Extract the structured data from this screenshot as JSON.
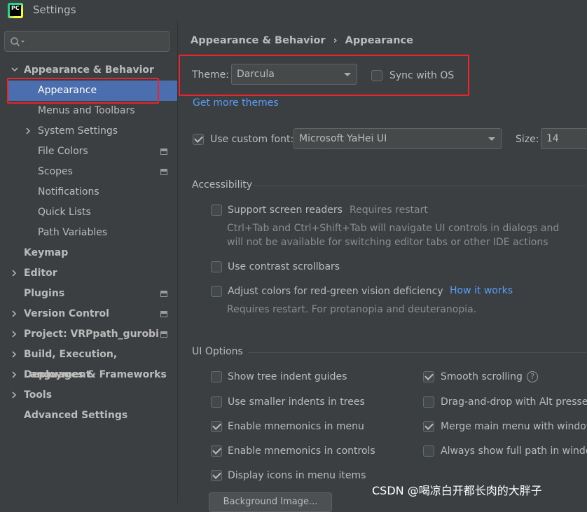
{
  "window": {
    "title": "Settings",
    "app_icon_text": "PC"
  },
  "sidebar": {
    "search_placeholder": "",
    "items": [
      {
        "label": "Appearance & Behavior"
      },
      {
        "label": "Appearance"
      },
      {
        "label": "Menus and Toolbars"
      },
      {
        "label": "System Settings"
      },
      {
        "label": "File Colors"
      },
      {
        "label": "Scopes"
      },
      {
        "label": "Notifications"
      },
      {
        "label": "Quick Lists"
      },
      {
        "label": "Path Variables"
      },
      {
        "label": "Keymap"
      },
      {
        "label": "Editor"
      },
      {
        "label": "Plugins"
      },
      {
        "label": "Version Control"
      },
      {
        "label": "Project: VRPpath_gurobi"
      },
      {
        "label": "Build, Execution, Deployment"
      },
      {
        "label": "Languages & Frameworks"
      },
      {
        "label": "Tools"
      },
      {
        "label": "Advanced Settings"
      }
    ]
  },
  "breadcrumb": {
    "parent": "Appearance & Behavior",
    "separator": "›",
    "current": "Appearance"
  },
  "theme": {
    "label": "Theme:",
    "value": "Darcula",
    "sync_label": "Sync with OS",
    "get_more": "Get more themes"
  },
  "font": {
    "use_custom_label": "Use custom font:",
    "value": "Microsoft YaHei UI",
    "size_label": "Size:",
    "size_value": "14"
  },
  "accessibility": {
    "header": "Accessibility",
    "screen_readers": "Support screen readers",
    "requires_restart": "Requires restart",
    "screen_readers_hint_1": "Ctrl+Tab and Ctrl+Shift+Tab will navigate UI controls in dialogs and",
    "screen_readers_hint_2": "will not be available for switching editor tabs or other IDE actions",
    "contrast_scrollbars": "Use contrast scrollbars",
    "adjust_colors": "Adjust colors for red-green vision deficiency",
    "how_it_works": "How it works",
    "adjust_hint": "Requires restart. For protanopia and deuteranopia."
  },
  "ui_options": {
    "header": "UI Options",
    "tree_indent_guides": "Show tree indent guides",
    "smaller_indents": "Use smaller indents in trees",
    "mnemonics_menu": "Enable mnemonics in menu",
    "mnemonics_controls": "Enable mnemonics in controls",
    "display_icons": "Display icons in menu items",
    "smooth_scrolling": "Smooth scrolling",
    "drag_drop_alt": "Drag-and-drop with Alt pressed",
    "merge_main_menu": "Merge main menu with window",
    "full_path": "Always show full path in window",
    "background_image": "Background Image..."
  },
  "watermark": "CSDN @喝凉白开都长肉的大胖子",
  "colors": {
    "accent": "#4b6eaf",
    "link": "#589df6",
    "highlight_box": "#e8262b"
  }
}
